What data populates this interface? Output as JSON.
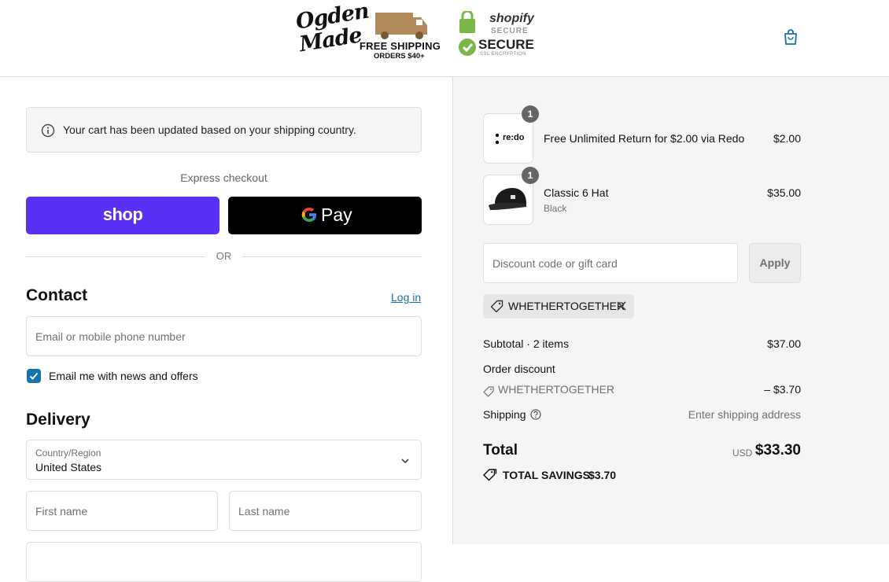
{
  "header": {
    "brand_logo_lines": [
      "Ogden",
      "Made"
    ],
    "shipping_badge_line1": "FREE SHIPPING",
    "shipping_badge_line2": "ORDERS $40+",
    "secure_brand": "shopify",
    "secure_brand_sub": "SECURE",
    "secure_title": "SECURE",
    "secure_subtitle": "SSL ENCRYPTION",
    "cart_icon": "shopping-bag-icon"
  },
  "notice": {
    "icon": "info-icon",
    "text": "Your cart has been updated based on your shipping country."
  },
  "express": {
    "label": "Express checkout",
    "shop_label": "shop",
    "gpay_label": "Pay",
    "or_label": "OR"
  },
  "contact": {
    "heading": "Contact",
    "login_label": "Log in",
    "email_placeholder": "Email or mobile phone number",
    "newsletter_label": "Email me with news and offers",
    "newsletter_checked": true
  },
  "delivery": {
    "heading": "Delivery",
    "country_label": "Country/Region",
    "country_value": "United States",
    "first_name_placeholder": "First name",
    "last_name_placeholder": "Last name"
  },
  "summary": {
    "items": [
      {
        "name": "Free Unlimited Return for $2.00 via Redo",
        "variant": "",
        "price": "$2.00",
        "qty": "1",
        "thumb_text": "re:do"
      },
      {
        "name": "Classic 6 Hat",
        "variant": "Black",
        "price": "$35.00",
        "qty": "1",
        "thumb_text": ""
      }
    ],
    "discount_placeholder": "Discount code or gift card",
    "apply_label": "Apply",
    "applied_code": "WHETHERTOGETHER",
    "subtotal_label": "Subtotal · 2 items",
    "subtotal_value": "$37.00",
    "order_discount_label": "Order discount",
    "order_discount_code": "WHETHERTOGETHER",
    "order_discount_value": "– $3.70",
    "shipping_label": "Shipping",
    "shipping_value": "Enter shipping address",
    "total_label": "Total",
    "total_currency": "USD",
    "total_value": "$33.30",
    "savings_label": "TOTAL SAVINGS",
    "savings_value": "$3.70"
  },
  "colors": {
    "shop_pay": "#5a31f4",
    "link": "#1773b0",
    "checkbox": "#1773b0",
    "summary_bg": "#f5f5f5"
  }
}
